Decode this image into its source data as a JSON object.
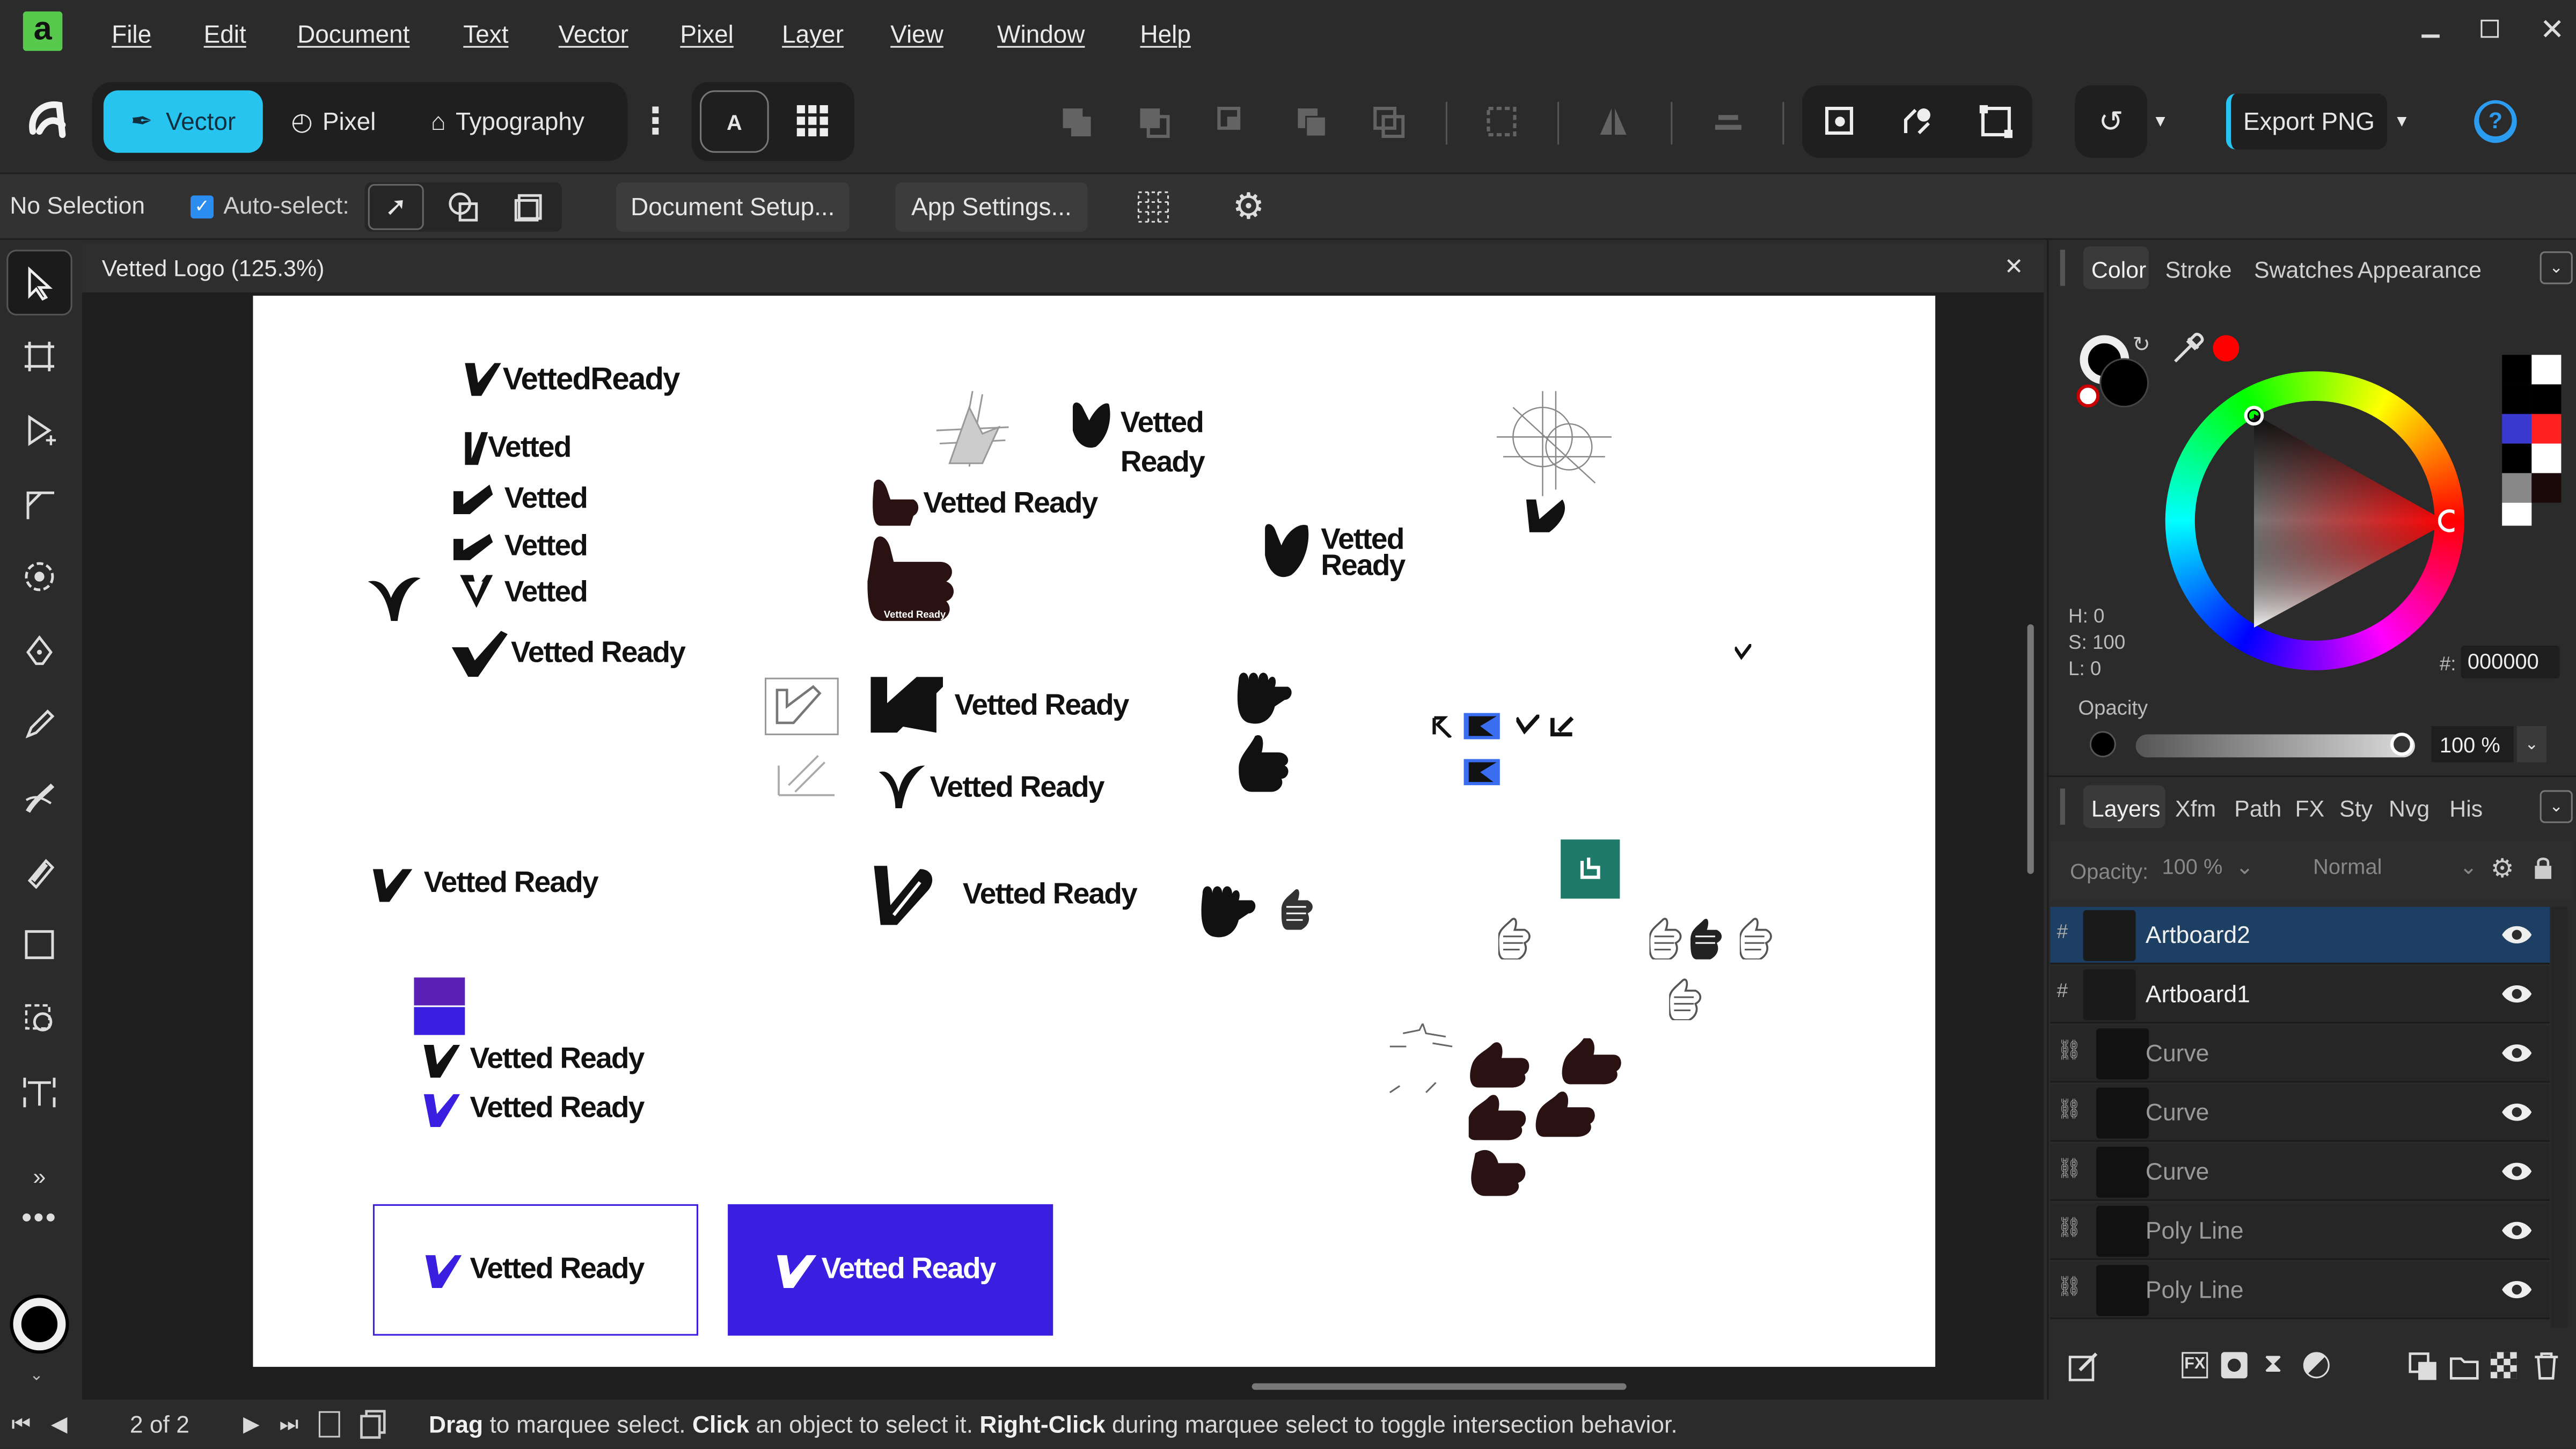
{
  "app": {
    "logo": "a"
  },
  "menu": [
    "File",
    "Edit",
    "Document",
    "Text",
    "Vector",
    "Pixel",
    "Layer",
    "View",
    "Window",
    "Help"
  ],
  "personas": {
    "vector": "Vector",
    "pixel": "Pixel",
    "typography": "Typography"
  },
  "export": {
    "label": "Export PNG"
  },
  "context": {
    "selection": "No Selection",
    "auto_select": "Auto-select:",
    "document_setup": "Document Setup...",
    "app_settings": "App Settings..."
  },
  "document": {
    "tab_title": "Vetted Logo (125.3%)"
  },
  "artboard_texts": {
    "vr1": "VettedReady",
    "v1": "Vetted",
    "v2": "Vetted",
    "v3": "Vetted",
    "v4": "Vetted",
    "vr2": "Vetted Ready",
    "vr3": "Vetted Ready",
    "vetted_line": "Vetted",
    "ready_line": "Ready",
    "vetted_line2": "Vetted",
    "ready_line2": "Ready",
    "thumb_small": "Vetted Ready",
    "vr4": "Vetted Ready",
    "vr5": "Vetted Ready",
    "vr6": "Vetted Ready",
    "vr7": "Vetted Ready",
    "vr8": "Vetted Ready",
    "vr9": "Vetted Ready",
    "vr10": "Vetted Ready",
    "vr11": "Vetted Ready"
  },
  "color_panel": {
    "tabs": [
      "Color",
      "Stroke",
      "Swatches",
      "Appearance"
    ],
    "h": "H: 0",
    "s": "S: 100",
    "l": "L: 0",
    "hex_label": "#:",
    "hex": "000000",
    "opacity_label": "Opacity",
    "opacity": "100 %",
    "accent": "#ff0000"
  },
  "layers_panel": {
    "tabs": [
      "Layers",
      "Xfm",
      "Path",
      "FX",
      "Sty",
      "Nvg",
      "His"
    ],
    "opacity_label": "Opacity:",
    "opacity": "100 %",
    "blend": "Normal",
    "rows": [
      {
        "name": "Artboard2",
        "selected": true
      },
      {
        "name": "Artboard1",
        "selected": false
      },
      {
        "name": "Curve",
        "selected": false
      },
      {
        "name": "Curve",
        "selected": false
      },
      {
        "name": "Curve",
        "selected": false
      },
      {
        "name": "Poly Line",
        "selected": false
      },
      {
        "name": "Poly Line",
        "selected": false
      }
    ]
  },
  "status": {
    "page": "2 of 2",
    "hint_b1": "Drag",
    "hint_t1": " to marquee select. ",
    "hint_b2": "Click",
    "hint_t2": " an object to select it. ",
    "hint_b3": "Right-Click",
    "hint_t3": " during marquee select to toggle intersection behavior."
  },
  "colors": {
    "accent": "#27c4ef",
    "brand_purple": "#3a1fe0",
    "teal": "#1f7a6a"
  }
}
